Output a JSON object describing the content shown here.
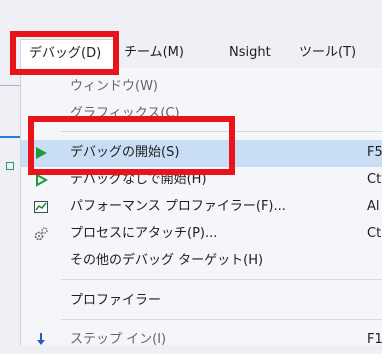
{
  "menubar": {
    "items": [
      "デバッグ(D)",
      "チーム(M)",
      "Nsight",
      "ツール(T)"
    ]
  },
  "dropdown": {
    "items": [
      {
        "label": "ウィンドウ(W)",
        "shortcut": ""
      },
      {
        "label": "グラフィックス(C)",
        "shortcut": ""
      },
      {
        "label": "デバッグの開始(S)",
        "shortcut": "F5",
        "icon": "play-green-icon"
      },
      {
        "label": "デバッグなしで開始(H)",
        "shortcut": "Ct",
        "icon": "play-outline-green-icon"
      },
      {
        "label": "パフォーマンス プロファイラー(F)...",
        "shortcut": "Al",
        "icon": "performance-chart-icon"
      },
      {
        "label": "プロセスにアタッチ(P)...",
        "shortcut": "Ct",
        "icon": "attach-gears-icon"
      },
      {
        "label": "その他のデバッグ ターゲット(H)",
        "shortcut": ""
      },
      {
        "label": "プロファイラー",
        "shortcut": ""
      },
      {
        "label": "ステップ イン(I)",
        "shortcut": "F1",
        "icon": "step-into-icon"
      }
    ]
  },
  "colors": {
    "highlight": "#c9def5",
    "annotation_red": "#e8141a",
    "play_green": "#1e9b3c"
  }
}
